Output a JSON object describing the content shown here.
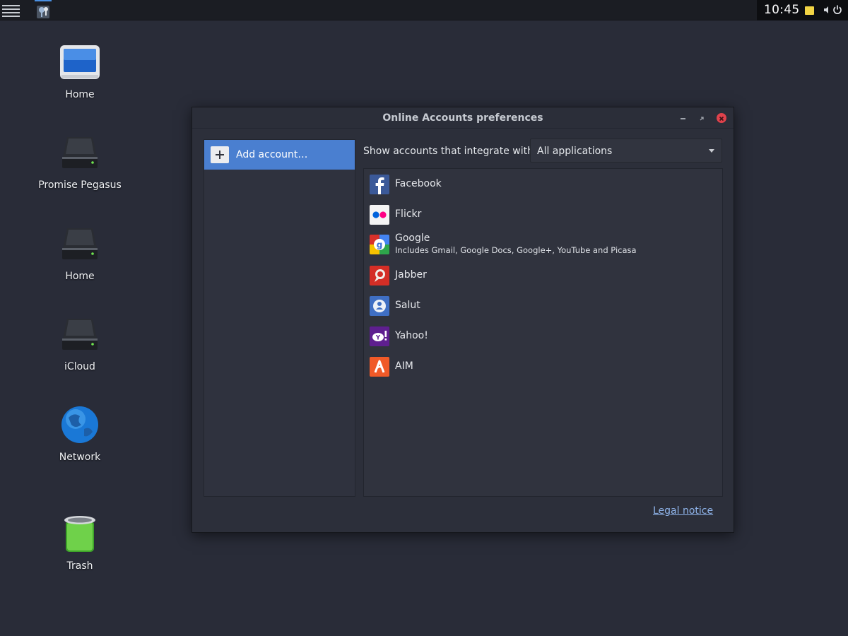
{
  "topbar": {
    "clock": "10:45"
  },
  "desktop": {
    "icons": [
      {
        "label": "Home",
        "icon": "monitor-icon"
      },
      {
        "label": "Promise Pegasus",
        "icon": "drive-icon"
      },
      {
        "label": "Home",
        "icon": "drive-icon"
      },
      {
        "label": "iCloud",
        "icon": "drive-icon"
      },
      {
        "label": "Network",
        "icon": "globe-icon"
      },
      {
        "label": "Trash",
        "icon": "trash-icon"
      }
    ]
  },
  "dialog": {
    "title": "Online Accounts preferences",
    "add_account_label": "Add account…",
    "filter_label": "Show accounts that integrate with:",
    "filter_value": "All applications",
    "providers": [
      {
        "name": "Facebook",
        "icon": "facebook-icon",
        "color": "#3b5998"
      },
      {
        "name": "Flickr",
        "icon": "flickr-icon",
        "color": "#f4f4f4"
      },
      {
        "name": "Google",
        "subtitle": "Includes Gmail, Google Docs, Google+, YouTube and Picasa",
        "icon": "google-icon"
      },
      {
        "name": "Jabber",
        "icon": "jabber-icon",
        "color": "#d42e26"
      },
      {
        "name": "Salut",
        "icon": "salut-icon",
        "color": "#3f6fc4"
      },
      {
        "name": "Yahoo!",
        "icon": "yahoo-icon",
        "color": "#5e1f8f"
      },
      {
        "name": "AIM",
        "icon": "aim-icon",
        "color": "#f05a28"
      }
    ],
    "legal_label": "Legal notice"
  },
  "colors": {
    "accent": "#4a7fd0",
    "close": "#e0424c"
  }
}
